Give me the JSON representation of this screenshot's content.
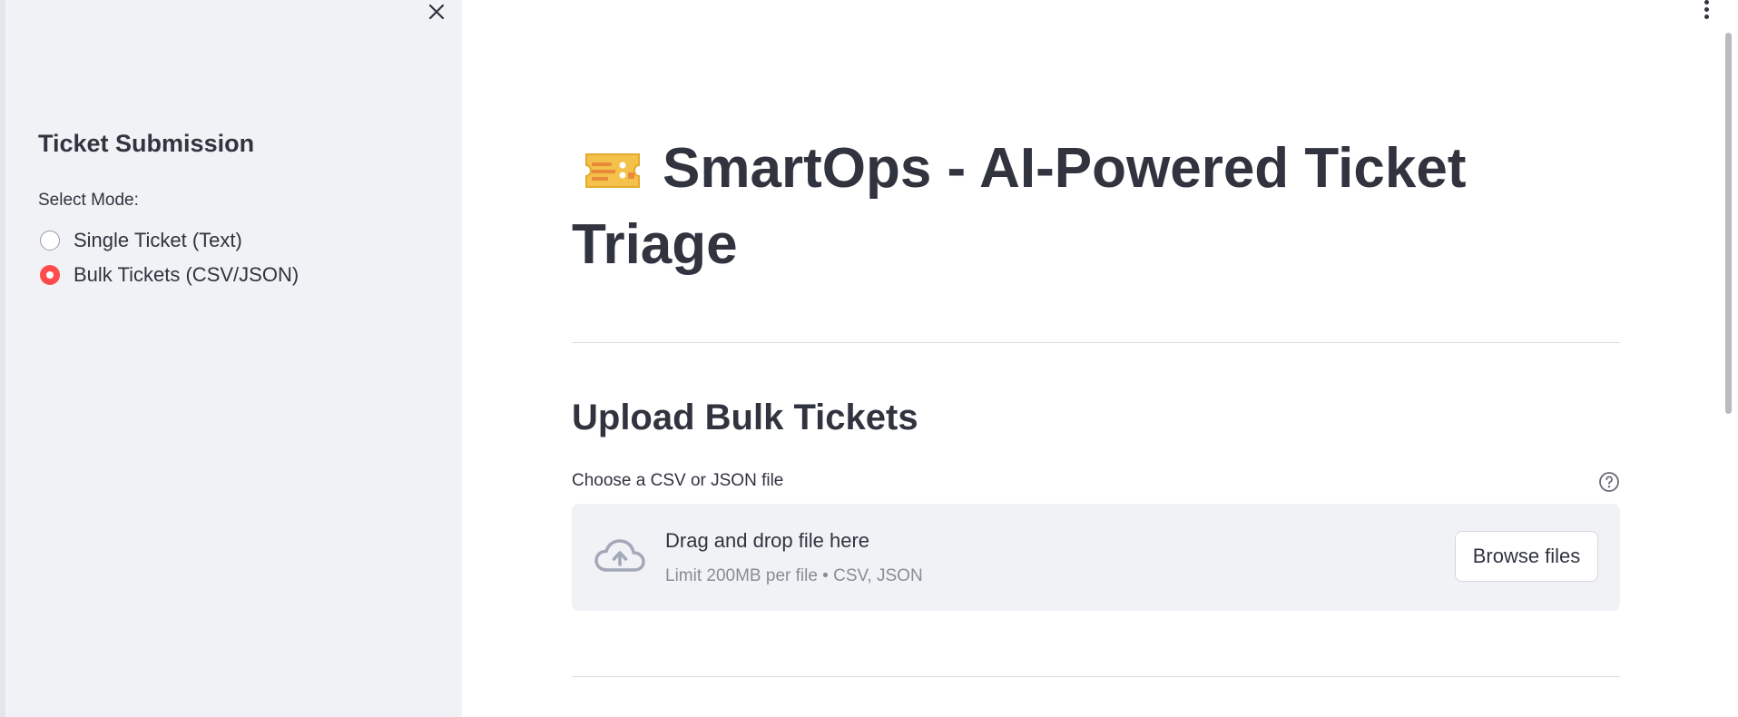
{
  "sidebar": {
    "title": "Ticket Submission",
    "mode_label": "Select Mode:",
    "options": [
      {
        "label": "Single Ticket (Text)",
        "selected": false
      },
      {
        "label": "Bulk Tickets (CSV/JSON)",
        "selected": true
      }
    ],
    "close_icon": "close-icon"
  },
  "main": {
    "title_icon": "ticket-icon",
    "title": "SmartOps - AI-Powered Ticket Triage",
    "section_title": "Upload Bulk Tickets",
    "uploader": {
      "label": "Choose a CSV or JSON file",
      "help_icon": "help-icon",
      "drop_text": "Drag and drop file here",
      "limit_text": "Limit 200MB per file • CSV, JSON",
      "browse_label": "Browse files",
      "upload_icon": "cloud-upload-icon"
    },
    "menu_icon": "kebab-menu-icon"
  },
  "colors": {
    "accent": "#ff4b4b",
    "sidebar_bg": "#f0f2f6",
    "text": "#31333f",
    "muted_text": "#8a8c95"
  }
}
